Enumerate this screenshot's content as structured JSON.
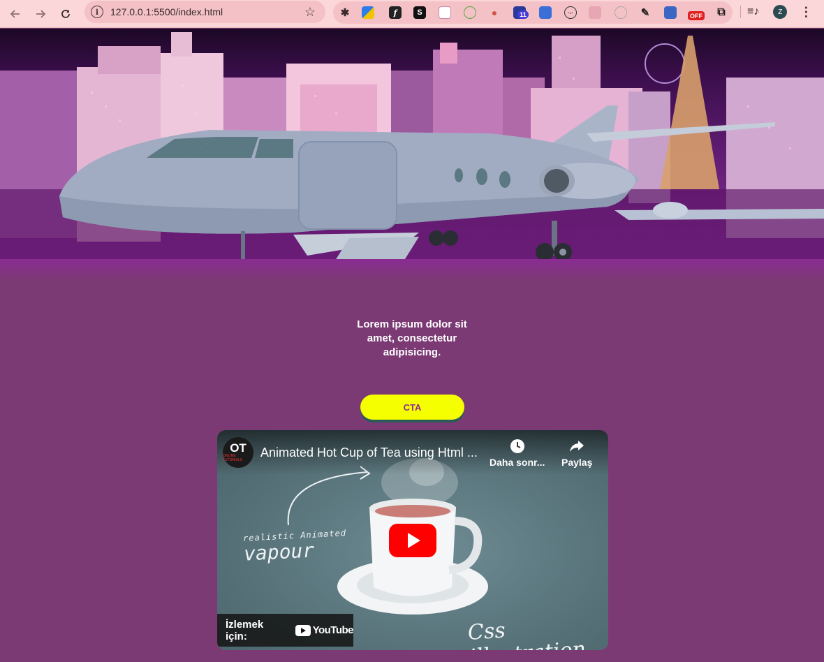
{
  "browser": {
    "url": "127.0.0.1:5500/index.html",
    "profile_initial": "Z",
    "extension_badge_count": "11",
    "extension_off_label": "OFF"
  },
  "hero": {
    "image_description_icon": "las-vegas-private-jet-hero"
  },
  "content": {
    "headline": "Lorem ipsum dolor sit amet, consectetur adipisicing.",
    "cta_label": "CTA"
  },
  "video": {
    "title": "Animated Hot Cup of Tea using Html ...",
    "channel_logo_text": "OT",
    "channel_logo_sub": "ONLINE TUTORIALS",
    "watch_later_label": "Daha sonr...",
    "share_label": "Paylaş",
    "watch_on_label": "İzlemek için:",
    "youtube_word": "YouTube",
    "overlay_text_small": "realistic Animated",
    "overlay_text_large": "vapour",
    "overlay_text_signature": "Css illustration"
  },
  "colors": {
    "page_bg": "#7b3a74",
    "cta_bg": "#f6ff00",
    "cta_text": "#8a2c92",
    "chrome_bg": "#fbd7d9",
    "youtube_red": "#ff0000"
  }
}
